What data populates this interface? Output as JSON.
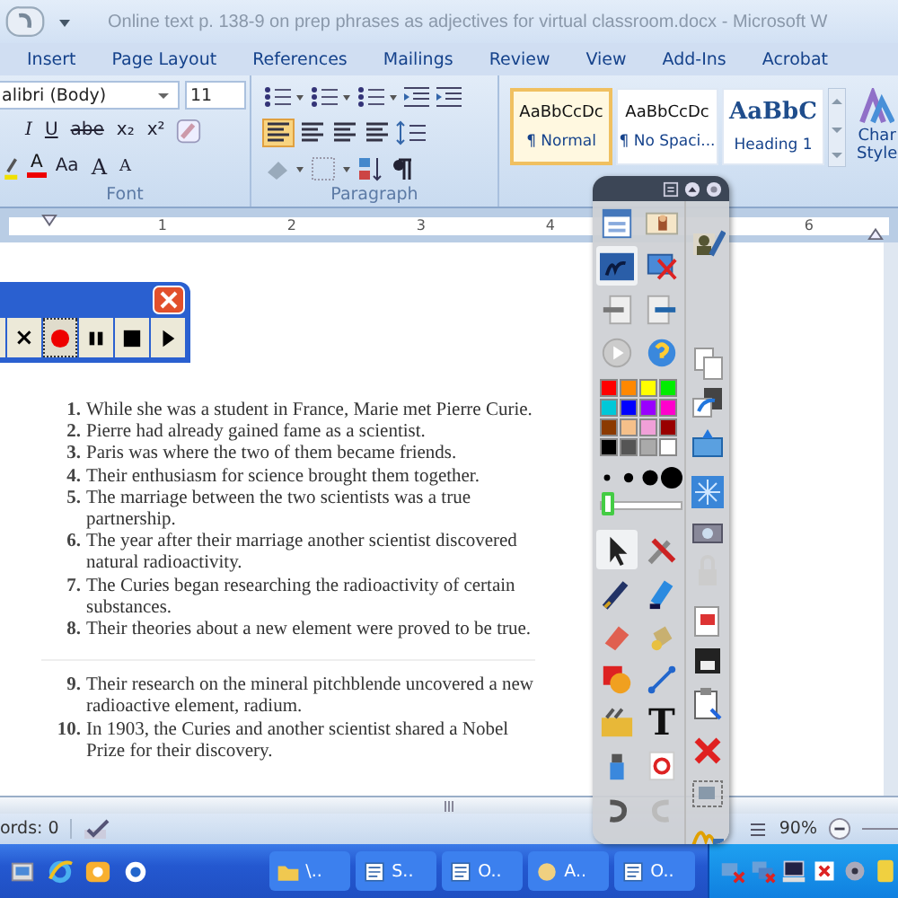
{
  "title": "Online text p. 138-9 on prep phrases as adjectives for virtual classroom.docx - Microsoft W",
  "tabs": [
    "Insert",
    "Page Layout",
    "References",
    "Mailings",
    "Review",
    "View",
    "Add-Ins",
    "Acrobat"
  ],
  "font_group": {
    "font": "alibri (Body)",
    "size": "11",
    "row2": [
      "I",
      "U",
      "abe",
      "x₂",
      "x²"
    ],
    "row3": [
      "A",
      "Aa",
      "A",
      "A"
    ],
    "label": "Font"
  },
  "paragraph_group": {
    "label": "Paragraph"
  },
  "styles": [
    {
      "preview": "AaBbCcDc",
      "name": "¶ Normal",
      "kind": "body",
      "selected": true
    },
    {
      "preview": "AaBbCcDc",
      "name": "¶ No Spaci...",
      "kind": "body",
      "selected": false
    },
    {
      "preview": "AaBbC",
      "name": "Heading 1",
      "kind": "heading",
      "selected": false
    }
  ],
  "change_styles": [
    "Char",
    "Style"
  ],
  "ruler": {
    "numbers": [
      "1",
      "2",
      "3",
      "4"
    ],
    "right_number": "6"
  },
  "recorder": {
    "buttons": [
      {
        "kind": "cancel",
        "label": "×",
        "selected": false
      },
      {
        "kind": "record",
        "selected": true
      },
      {
        "kind": "pause",
        "selected": false
      },
      {
        "kind": "stop",
        "selected": false
      },
      {
        "kind": "play",
        "selected": false
      }
    ]
  },
  "list_sections": [
    {
      "items": [
        {
          "number": "1.",
          "text": "While she was a student in France, Marie met Pierre Curie."
        },
        {
          "number": "2.",
          "text": "Pierre had already gained fame as a scientist."
        },
        {
          "number": "3.",
          "text": "Paris was where the two of them became friends."
        },
        {
          "number": "4.",
          "text": "Their enthusiasm for science brought them together."
        },
        {
          "number": "5.",
          "text": "The marriage between the two scientists was a true partnership."
        },
        {
          "number": "6.",
          "text": "The year after their marriage another scientist discovered natural radioactivity."
        },
        {
          "number": "7.",
          "text": "The Curies began researching the radioactivity of certain substances."
        },
        {
          "number": "8.",
          "text": "Their theories about a new element were proved to be true."
        }
      ]
    },
    {
      "items": [
        {
          "number": "9.",
          "text": "Their research on the mineral pitchblende uncovered a new radioactive element, radium."
        },
        {
          "number": "10.",
          "text": "In 1903, the Curies and another scientist shared a Nobel Prize for their discovery."
        }
      ]
    }
  ],
  "palette": {
    "pen_selected": true,
    "pointer_selected": true,
    "text_tool": "T",
    "slider": {
      "level": 0
    },
    "swatches": [
      {
        "color": "#ff0000"
      },
      {
        "color": "#ff8800"
      },
      {
        "color": "#ffff00"
      },
      {
        "color": "#00ee00"
      },
      {
        "color": "#00c8d8"
      },
      {
        "color": "#0000ff"
      },
      {
        "color": "#9900ff"
      },
      {
        "color": "#ff00cc"
      },
      {
        "color": "#8b3a00"
      },
      {
        "color": "#f5c08a"
      },
      {
        "color": "#f0a0d8"
      },
      {
        "color": "#990000"
      },
      {
        "color": "#000000"
      },
      {
        "color": "#555555"
      },
      {
        "color": "#aaaaaa"
      },
      {
        "color": "#ffffff"
      }
    ]
  },
  "status_bar": {
    "words": "ords: 0",
    "zoom": "90%"
  },
  "taskbar": {
    "buttons": [
      {
        "kind": "folder",
        "label": "\\.."
      },
      {
        "kind": "document",
        "label": "S.."
      },
      {
        "kind": "document",
        "label": "O.."
      },
      {
        "kind": "app",
        "label": "A.."
      },
      {
        "kind": "document",
        "label": "O.."
      }
    ]
  }
}
